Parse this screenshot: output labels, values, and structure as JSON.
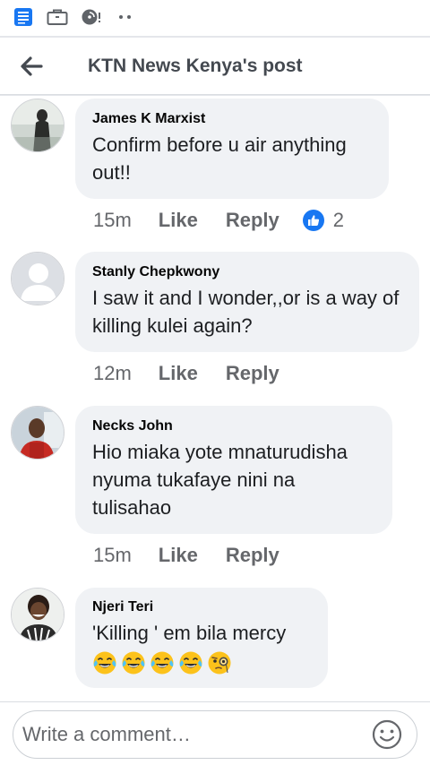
{
  "status_bar": {
    "icons": [
      "news-app-icon",
      "briefcase-icon",
      "wifi-icon",
      "dots-icon"
    ]
  },
  "header": {
    "title": "KTN News Kenya's post",
    "back_icon": "arrow-left-icon"
  },
  "comments": [
    {
      "author": "James K Marxist",
      "text": "Confirm before u air anything out!!",
      "time": "15m",
      "like_label": "Like",
      "reply_label": "Reply",
      "reaction_count": "2",
      "reaction_icon": "thumbs-up-icon"
    },
    {
      "author": "Stanly Chepkwony",
      "text": "I saw it and I wonder,,or is a way of killing kulei again?",
      "time": "12m",
      "like_label": "Like",
      "reply_label": "Reply"
    },
    {
      "author": "Necks John",
      "text": "Hio miaka yote mnaturudisha nyuma tukafaye nini na tulisahao",
      "time": "15m",
      "like_label": "Like",
      "reply_label": "Reply"
    },
    {
      "author": "Njeri Teri",
      "text": "'Killing '  em bila mercy",
      "emojis": [
        "tears-of-joy-emoji",
        "tears-of-joy-emoji",
        "tears-of-joy-emoji",
        "tears-of-joy-emoji",
        "monocle-face-emoji"
      ]
    }
  ],
  "composer": {
    "placeholder": "Write a comment…",
    "emoji_icon": "smiley-icon"
  },
  "colors": {
    "bubble": "#f0f2f5",
    "meta_text": "#65676b",
    "like_blue": "#1877f2",
    "status_icon_blue": "#1877f2"
  }
}
